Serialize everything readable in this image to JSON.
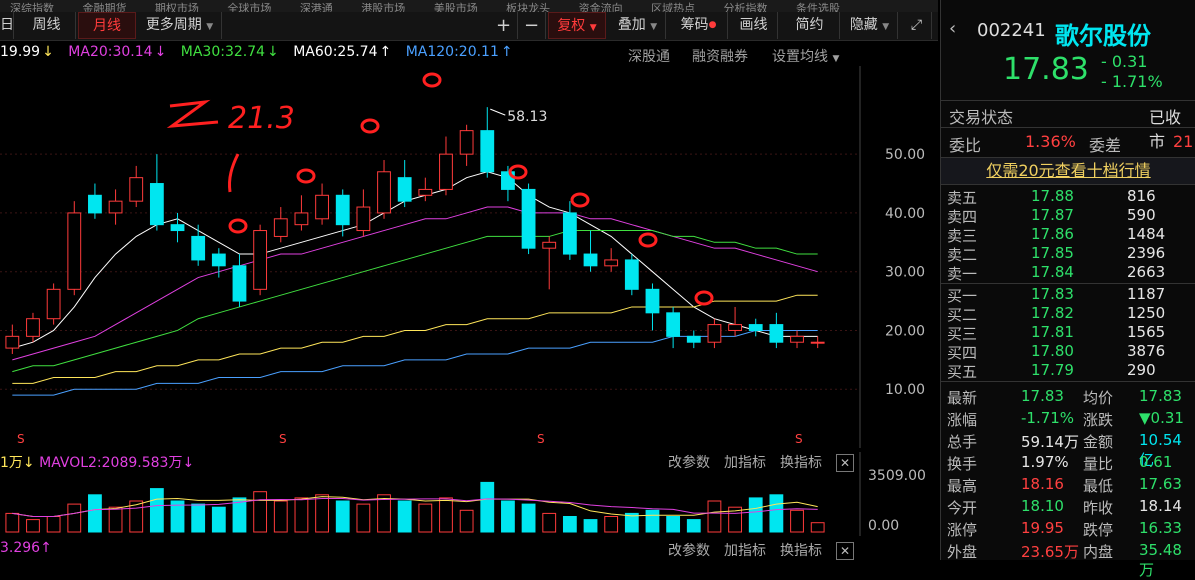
{
  "topnav": [
    "深综指数",
    "金融期货",
    "期权市场",
    "全球市场",
    "深港通",
    "港股市场",
    "美股市场",
    "板块龙头",
    "资金流向",
    "区域热点",
    "分析指数",
    "条件选股"
  ],
  "toolbar": {
    "periods": [
      "日",
      "周线",
      "月线",
      "更多周期"
    ],
    "active_period": "月线",
    "plus": "+",
    "minus": "−",
    "fuquan": "复权",
    "diejia": "叠加",
    "chouma": "筹码",
    "huaxian": "画线",
    "jianyue": "简约",
    "yincang": "隐藏"
  },
  "ma_legend": {
    "ma10": "19.99",
    "ma20": "MA20:30.14",
    "ma30": "MA30:32.74",
    "ma60": "MA60:25.74",
    "ma120": "MA120:20.11",
    "links": [
      "深股通",
      "融资融券",
      "设置均线"
    ]
  },
  "colors": {
    "up": "#ff3b3b",
    "down": "#00e6f0",
    "ma10": "#ffffff",
    "ma20": "#e040e0",
    "ma30": "#40e040",
    "ma60": "#ffe65a",
    "ma120": "#4aa0ff",
    "accent": "#00e6f0"
  },
  "chart_data": {
    "type": "candlestick",
    "y_ticks": [
      "50.00",
      "40.00",
      "30.00",
      "20.00",
      "10.00"
    ],
    "ylim": [
      0,
      65
    ],
    "high_label": "58.13",
    "candles": [
      [
        17,
        19,
        16,
        21
      ],
      [
        19,
        22,
        18,
        23
      ],
      [
        22,
        27,
        21,
        28
      ],
      [
        27,
        40,
        26,
        42
      ],
      [
        43,
        40,
        39,
        45
      ],
      [
        40,
        42,
        38,
        44
      ],
      [
        42,
        46,
        41,
        48
      ],
      [
        45,
        38,
        37,
        50
      ],
      [
        38,
        37,
        35,
        40
      ],
      [
        36,
        32,
        31,
        38
      ],
      [
        33,
        31,
        29,
        34
      ],
      [
        31,
        25,
        24,
        33
      ],
      [
        27,
        37,
        26,
        38
      ],
      [
        36,
        39,
        35,
        41
      ],
      [
        38,
        40,
        37,
        43
      ],
      [
        39,
        43,
        38,
        45
      ],
      [
        43,
        38,
        36,
        44
      ],
      [
        37,
        41,
        36,
        44
      ],
      [
        40,
        47,
        39,
        49
      ],
      [
        46,
        42,
        41,
        49
      ],
      [
        43,
        44,
        42,
        46
      ],
      [
        44,
        50,
        43,
        53
      ],
      [
        50,
        54,
        48,
        55
      ],
      [
        54,
        47,
        46,
        58
      ],
      [
        47,
        44,
        42,
        48
      ],
      [
        44,
        34,
        33,
        45
      ],
      [
        34,
        35,
        27,
        36
      ],
      [
        40,
        33,
        32,
        42
      ],
      [
        33,
        31,
        30,
        37
      ],
      [
        31,
        32,
        30,
        34
      ],
      [
        32,
        27,
        26,
        33
      ],
      [
        27,
        23,
        20,
        28
      ],
      [
        23,
        19,
        17,
        24
      ],
      [
        19,
        18,
        17,
        20
      ],
      [
        18,
        21,
        17,
        22
      ],
      [
        20,
        21,
        19,
        24
      ],
      [
        21,
        20,
        19,
        22
      ],
      [
        21,
        18,
        17,
        23
      ],
      [
        18,
        19,
        17,
        20
      ],
      [
        18,
        18,
        17,
        19
      ]
    ],
    "ma_series": {
      "ma10": [
        17,
        18,
        20,
        24,
        29,
        33,
        36,
        38,
        39,
        37,
        35,
        33,
        33,
        34,
        35,
        36,
        37,
        38,
        40,
        42,
        43,
        44,
        46,
        47,
        46,
        43,
        41,
        40,
        38,
        36,
        33,
        30,
        27,
        24,
        22,
        21,
        20,
        19,
        19,
        19
      ],
      "ma20": [
        15,
        16,
        17,
        18,
        19,
        21,
        23,
        25,
        27,
        29,
        30,
        31,
        32,
        33,
        33,
        34,
        35,
        36,
        37,
        38,
        39,
        39,
        40,
        41,
        41,
        40,
        40,
        40,
        39,
        39,
        38,
        37,
        36,
        35,
        34,
        34,
        33,
        32,
        31,
        30
      ],
      "ma30": [
        13,
        14,
        14,
        15,
        16,
        17,
        18,
        19,
        20,
        22,
        23,
        24,
        25,
        26,
        27,
        28,
        29,
        30,
        31,
        32,
        33,
        34,
        35,
        36,
        36,
        36,
        36,
        37,
        37,
        37,
        37,
        37,
        36,
        36,
        35,
        35,
        34,
        34,
        33,
        33
      ],
      "ma60": [
        11,
        11,
        12,
        12,
        12,
        13,
        13,
        14,
        14,
        15,
        15,
        16,
        16,
        17,
        17,
        18,
        18,
        19,
        19,
        20,
        20,
        21,
        21,
        22,
        22,
        22,
        23,
        23,
        23,
        23,
        24,
        24,
        24,
        24,
        25,
        25,
        25,
        25,
        26,
        26
      ],
      "ma120": [
        9,
        9,
        9,
        10,
        10,
        10,
        10,
        11,
        11,
        11,
        12,
        12,
        12,
        13,
        13,
        13,
        14,
        14,
        14,
        15,
        15,
        15,
        16,
        16,
        16,
        17,
        17,
        17,
        18,
        18,
        18,
        18,
        19,
        19,
        19,
        19,
        20,
        20,
        20,
        20
      ]
    },
    "volume": [
      0.3,
      0.2,
      0.25,
      0.45,
      0.6,
      0.4,
      0.5,
      0.7,
      0.5,
      0.45,
      0.4,
      0.55,
      0.65,
      0.5,
      0.55,
      0.6,
      0.5,
      0.45,
      0.6,
      0.5,
      0.45,
      0.55,
      0.35,
      0.8,
      0.5,
      0.45,
      0.3,
      0.25,
      0.2,
      0.25,
      0.3,
      0.35,
      0.25,
      0.2,
      0.5,
      0.4,
      0.55,
      0.6,
      0.35,
      0.15
    ],
    "vol_ticks": [
      "3509.00",
      "0.00"
    ]
  },
  "annotations": {
    "high_text": "21.3"
  },
  "vol_legend": {
    "left": "1万",
    "mavol2": "MAVOL2:2089.583万",
    "bottom": "3.296",
    "links": [
      "改参数",
      "加指标",
      "换指标"
    ]
  },
  "panel": {
    "code": "002241",
    "name": "歌尔股份",
    "price": "17.83",
    "change": "- 0.31",
    "change_pct": "- 1.71%",
    "status_label": "交易状态",
    "status_value": "已收市",
    "weibi_label": "委比",
    "weibi_value": "1.36%",
    "weicha_label": "委差",
    "weicha_value": "21",
    "banner": "仅需20元查看十档行情",
    "asks": [
      [
        "卖五",
        "17.88",
        "816"
      ],
      [
        "卖四",
        "17.87",
        "590"
      ],
      [
        "卖三",
        "17.86",
        "1484"
      ],
      [
        "卖二",
        "17.85",
        "2396"
      ],
      [
        "卖一",
        "17.84",
        "2663"
      ]
    ],
    "bids": [
      [
        "买一",
        "17.83",
        "1187"
      ],
      [
        "买二",
        "17.82",
        "1250"
      ],
      [
        "买三",
        "17.81",
        "1565"
      ],
      [
        "买四",
        "17.80",
        "3876"
      ],
      [
        "买五",
        "17.79",
        "290"
      ]
    ],
    "stats": [
      [
        "最新",
        "17.83",
        "均价",
        "17.83"
      ],
      [
        "涨幅",
        "-1.71%",
        "涨跌",
        "▼0.31"
      ],
      [
        "总手",
        "59.14万",
        "金额",
        "10.54亿"
      ],
      [
        "换手",
        "1.97%",
        "量比",
        "0.61"
      ],
      [
        "最高",
        "18.16",
        "最低",
        "17.63"
      ],
      [
        "今开",
        "18.10",
        "昨收",
        "18.14"
      ],
      [
        "涨停",
        "19.95",
        "跌停",
        "16.33"
      ],
      [
        "外盘",
        "23.65万",
        "内盘",
        "35.48万"
      ]
    ]
  }
}
